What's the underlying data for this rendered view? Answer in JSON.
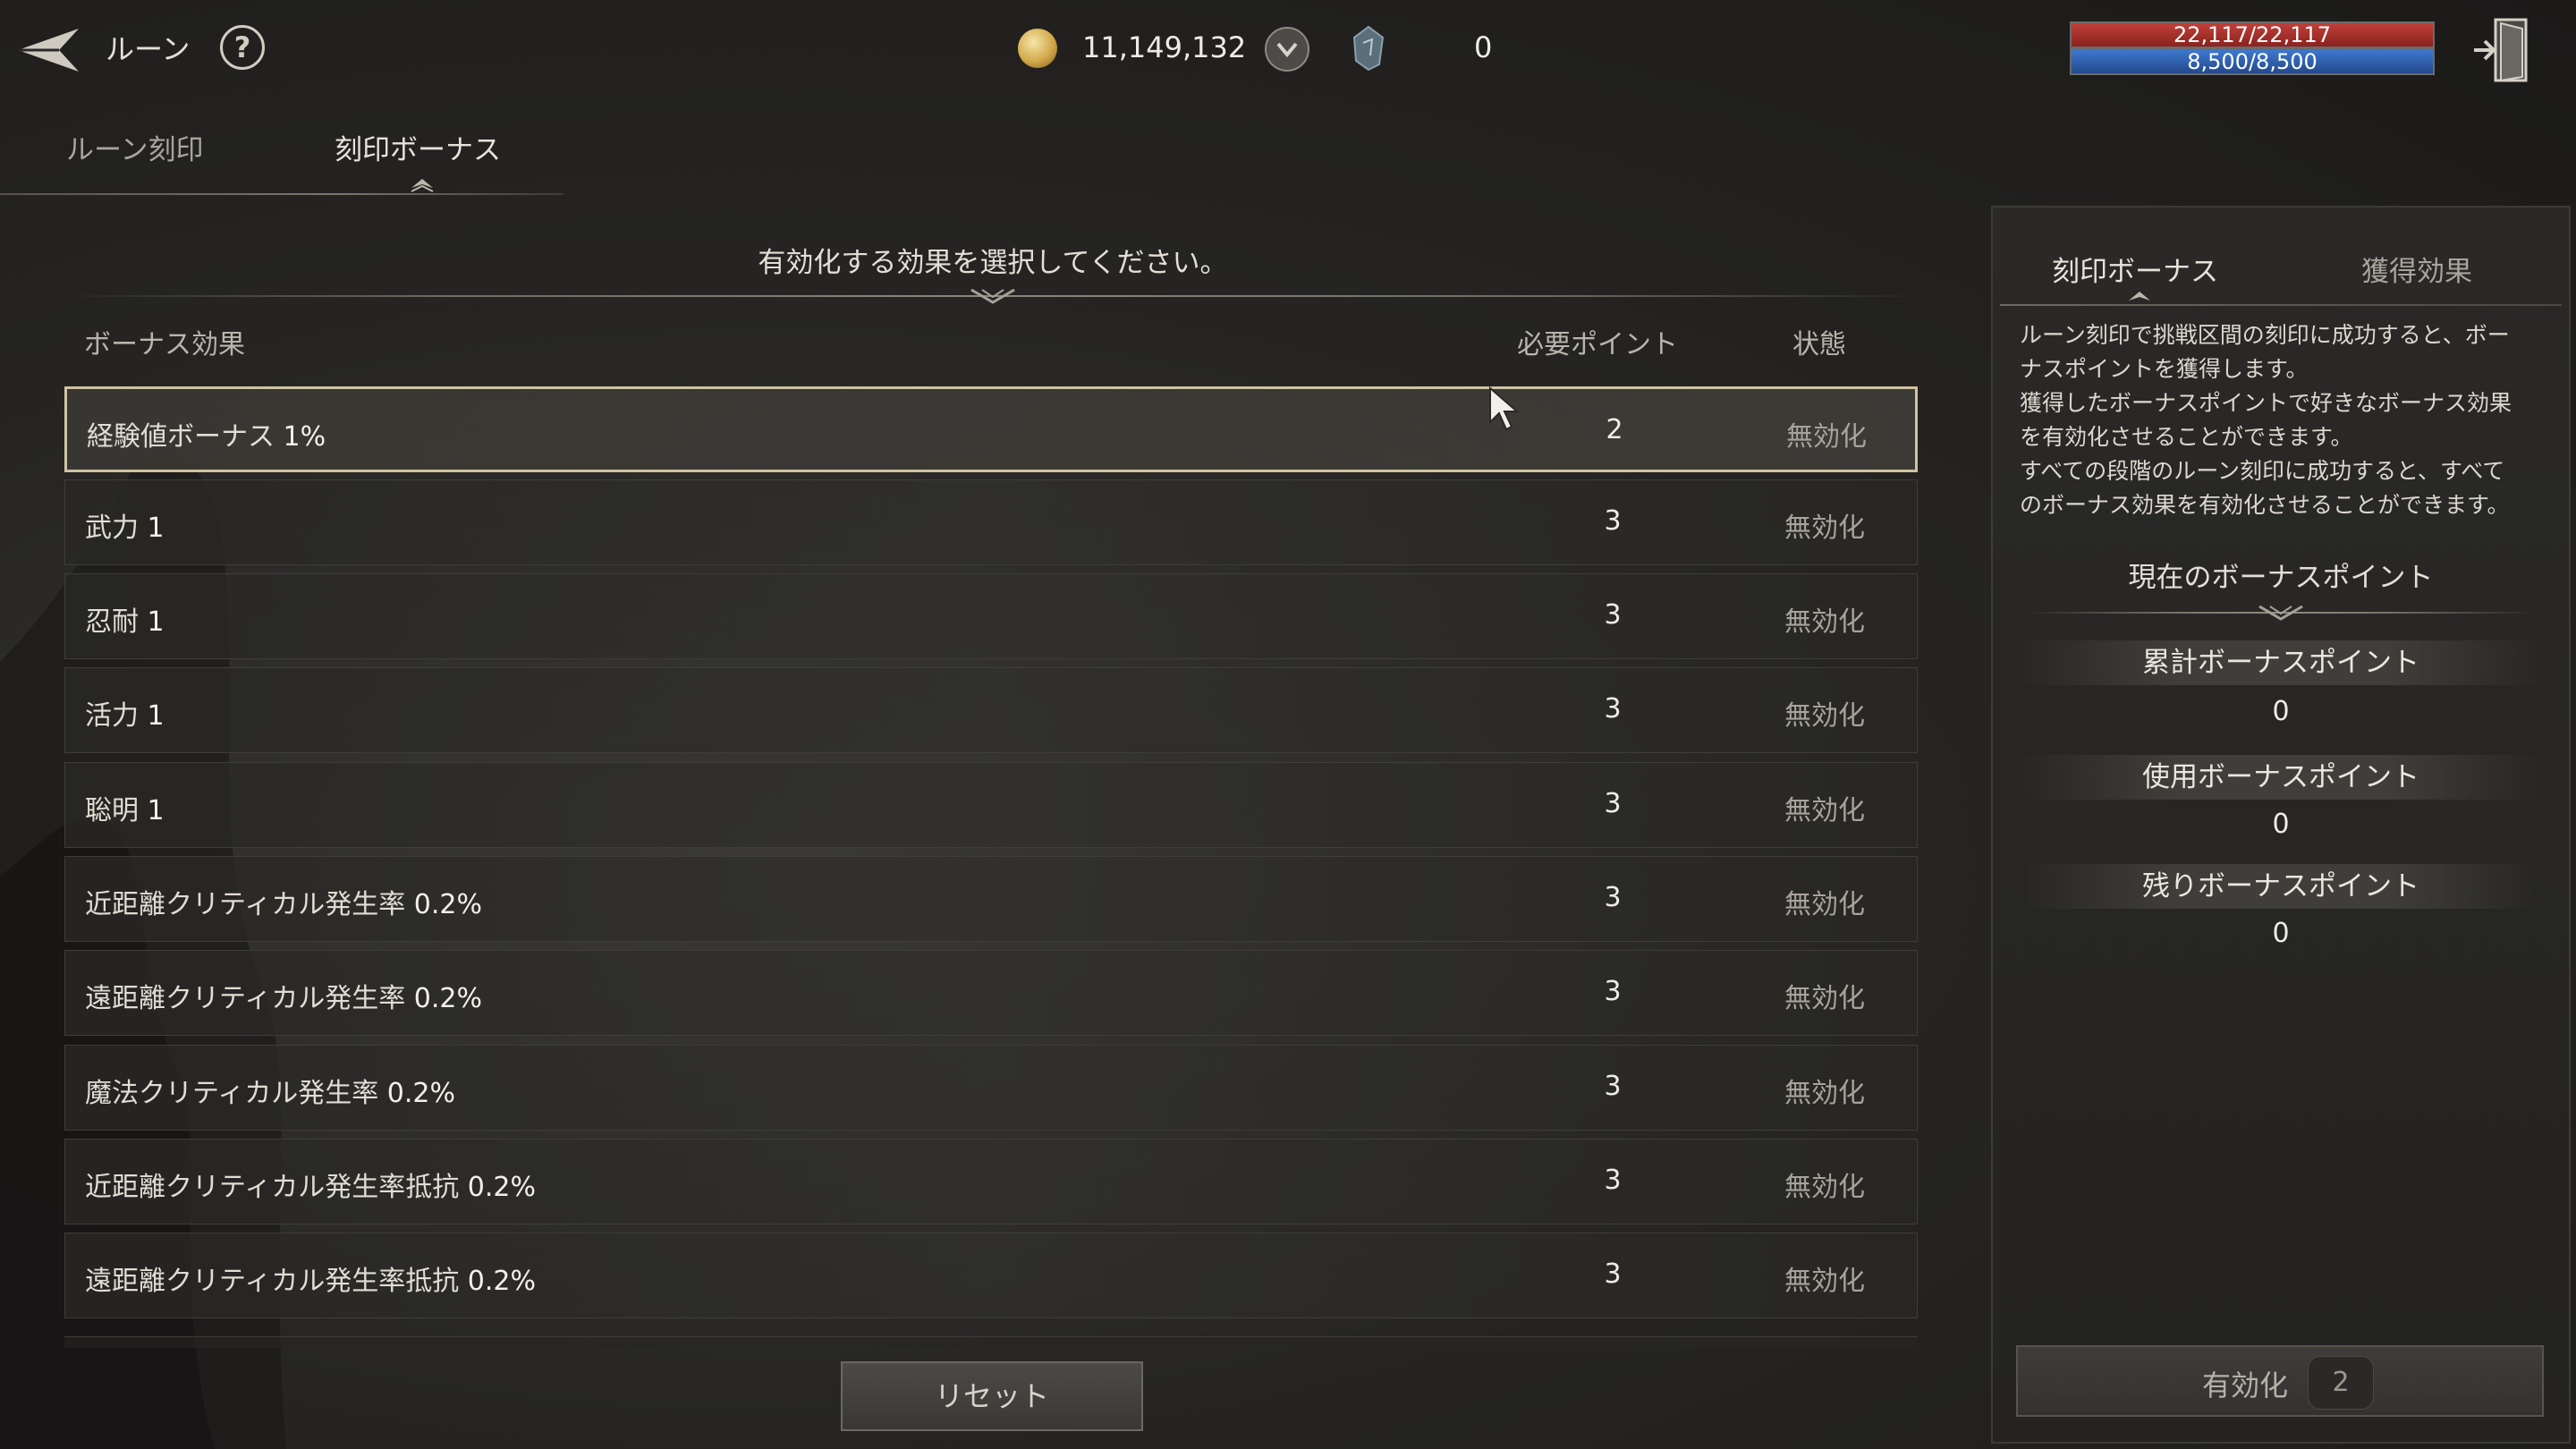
{
  "header": {
    "title": "ルーン",
    "help_symbol": "?",
    "gold": "11,149,132",
    "gem_count": "0",
    "hp": "22,117/22,117",
    "mp": "8,500/8,500"
  },
  "tabs": [
    {
      "label": "ルーン刻印",
      "active": false
    },
    {
      "label": "刻印ボーナス",
      "active": true
    }
  ],
  "bonus_list": {
    "instruction": "有効化する効果を選択してください。",
    "columns": {
      "effect": "ボーナス効果",
      "points": "必要ポイント",
      "status": "状態"
    },
    "rows": [
      {
        "name": "経験値ボーナス",
        "value": "1%",
        "points": "2",
        "status": "無効化",
        "selected": true
      },
      {
        "name": "武力",
        "value": "1",
        "points": "3",
        "status": "無効化"
      },
      {
        "name": "忍耐",
        "value": "1",
        "points": "3",
        "status": "無効化"
      },
      {
        "name": "活力",
        "value": "1",
        "points": "3",
        "status": "無効化"
      },
      {
        "name": "聡明",
        "value": "1",
        "points": "3",
        "status": "無効化"
      },
      {
        "name": "近距離クリティカル発生率",
        "value": "0.2%",
        "points": "3",
        "status": "無効化"
      },
      {
        "name": "遠距離クリティカル発生率",
        "value": "0.2%",
        "points": "3",
        "status": "無効化"
      },
      {
        "name": "魔法クリティカル発生率",
        "value": "0.2%",
        "points": "3",
        "status": "無効化"
      },
      {
        "name": "近距離クリティカル発生率抵抗",
        "value": "0.2%",
        "points": "3",
        "status": "無効化"
      },
      {
        "name": "遠距離クリティカル発生率抵抗",
        "value": "0.2%",
        "points": "3",
        "status": "無効化"
      }
    ],
    "reset_label": "リセット"
  },
  "side_panel": {
    "tabs": [
      {
        "label": "刻印ボーナス",
        "active": true
      },
      {
        "label": "獲得効果",
        "active": false
      }
    ],
    "description_lines": [
      "ルーン刻印で挑戦区間の刻印に成功すると、ボー",
      "ナスポイントを獲得します。",
      "獲得したボーナスポイントで好きなボーナス効果",
      "を有効化させることができます。",
      "すべての段階のルーン刻印に成功すると、すべて",
      "のボーナス効果を有効化させることができます。"
    ],
    "section_title": "現在のボーナスポイント",
    "points": [
      {
        "label": "累計ボーナスポイント",
        "value": "0"
      },
      {
        "label": "使用ボーナスポイント",
        "value": "0"
      },
      {
        "label": "残りボーナスポイント",
        "value": "0"
      }
    ],
    "activate_label": "有効化",
    "activate_count": "2"
  },
  "icons": {
    "back": "back-arrow-icon",
    "help": "help-icon",
    "coin": "gold-coin-icon",
    "shield": "shield-icon",
    "gem": "rune-gem-icon",
    "exit": "exit-door-icon",
    "cursor": "mouse-cursor-icon"
  },
  "colors": {
    "hp": "#b8332d",
    "mp": "#3568c0",
    "selected_border": "#cfc3a2",
    "background": "#262523"
  }
}
